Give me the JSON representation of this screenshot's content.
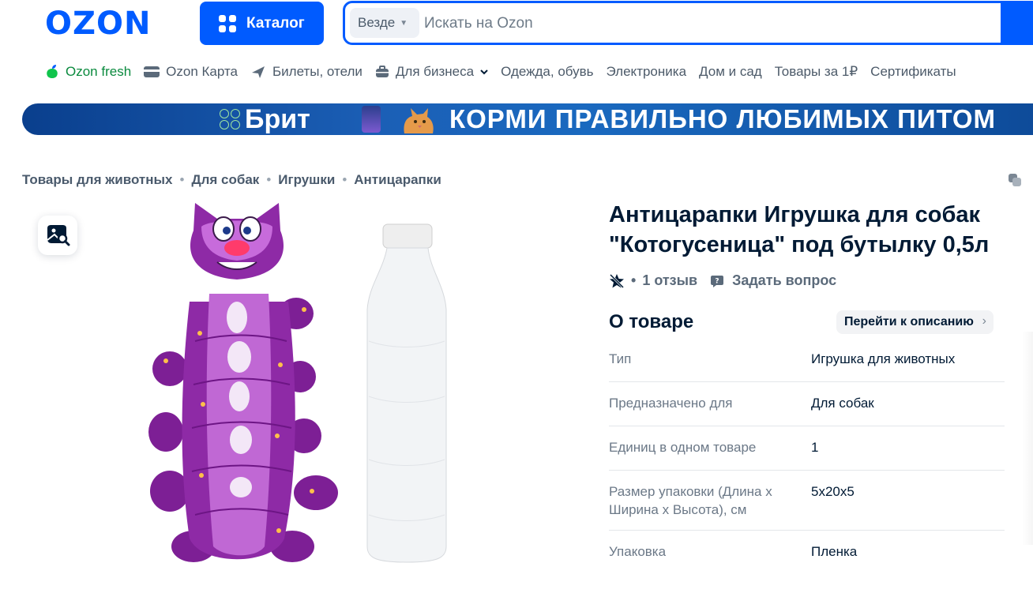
{
  "header": {
    "logo_text": "OZON",
    "catalog_label": "Каталог",
    "search": {
      "scope": "Везде",
      "placeholder": "Искать на Ozon"
    }
  },
  "nav": {
    "items": [
      {
        "label": "Ozon fresh",
        "icon": "fresh-icon"
      },
      {
        "label": "Ozon Карта",
        "icon": "card-icon"
      },
      {
        "label": "Билеты, отели",
        "icon": "plane-icon"
      },
      {
        "label": "Для бизнеса",
        "icon": "briefcase-icon"
      },
      {
        "label": "Одежда, обувь"
      },
      {
        "label": "Электроника"
      },
      {
        "label": "Дом и сад"
      },
      {
        "label": "Товары за 1₽"
      },
      {
        "label": "Сертификаты"
      }
    ]
  },
  "banner": {
    "brand": "Брит",
    "slogan": "КОРМИ ПРАВИЛЬНО ЛЮБИМЫХ ПИТОМ"
  },
  "breadcrumb": [
    "Товары для животных",
    "Для собак",
    "Игрушки",
    "Антицарапки"
  ],
  "product": {
    "title": "Антицарапки Игрушка для собак \"Котогусеница\" под бутылку 0,5л",
    "reviews": "1 отзыв",
    "ask_question": "Задать вопрос"
  },
  "about": {
    "heading": "О товаре",
    "goto_description": "Перейти к описанию",
    "specs": [
      {
        "key": "Тип",
        "value": "Игрушка для животных"
      },
      {
        "key": "Предназначено для",
        "value": "Для собак"
      },
      {
        "key": "Единиц в одном товаре",
        "value": "1"
      },
      {
        "key": "Размер упаковки (Длина х Ширина х Высота), см",
        "value": "5x20x5"
      },
      {
        "key": "Упаковка",
        "value": "Пленка"
      }
    ]
  },
  "colors": {
    "brand_blue": "#005bff",
    "toy_purple": "#8e2aa6",
    "fresh_green": "#0a8a3e"
  }
}
